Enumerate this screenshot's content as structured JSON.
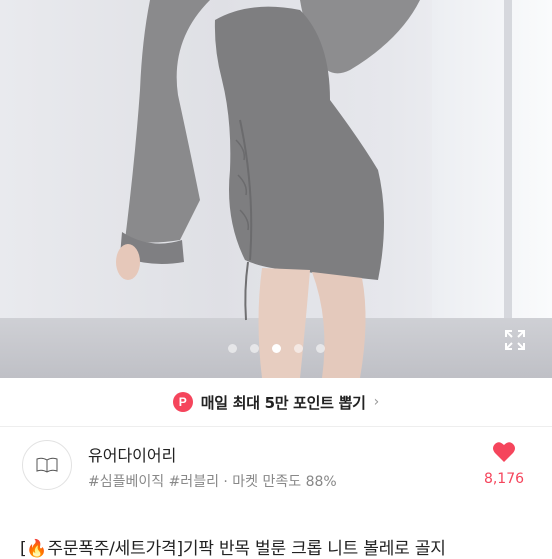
{
  "carousel": {
    "page_count": 5,
    "active_index": 2,
    "expand_icon": "expand-icon"
  },
  "promo": {
    "badge": "P",
    "text": "매일 최대 5만 포인트 뽑기",
    "chevron": "›"
  },
  "seller": {
    "name": "유어다이어리",
    "tags": "#심플베이직 #러블리 · 마켓 만족도 88%",
    "like_count": "8,176"
  },
  "product": {
    "title": "[🔥주문폭주/세트가격]기팍 반목 벌룬 크롭 니트 볼레로 골지"
  },
  "colors": {
    "accent": "#f5455c"
  }
}
